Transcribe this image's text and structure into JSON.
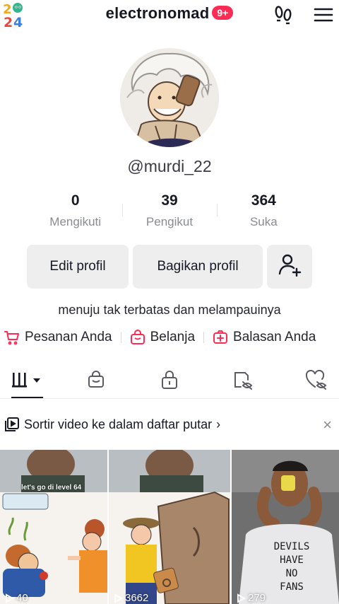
{
  "header": {
    "logo_text": "2024",
    "username": "electronomad",
    "notification_badge": "9+"
  },
  "profile": {
    "handle": "@murdi_22",
    "stats": [
      {
        "value": "0",
        "label": "Mengikuti"
      },
      {
        "value": "39",
        "label": "Pengikut"
      },
      {
        "value": "364",
        "label": "Suka"
      }
    ],
    "edit_button": "Edit profil",
    "share_button": "Bagikan profil",
    "bio": "menuju tak terbatas dan melampauinya"
  },
  "shortcuts": [
    {
      "label": "Pesanan Anda",
      "icon": "cart-icon"
    },
    {
      "label": "Belanja",
      "icon": "shopping-bag-icon"
    },
    {
      "label": "Balasan Anda",
      "icon": "reply-box-icon"
    }
  ],
  "tabs": [
    {
      "name": "videos-grid",
      "icon": "grid-icon",
      "active": true
    },
    {
      "name": "shop",
      "icon": "bag-icon"
    },
    {
      "name": "private",
      "icon": "lock-icon"
    },
    {
      "name": "reposts",
      "icon": "repost-hidden-icon"
    },
    {
      "name": "liked",
      "icon": "heart-hidden-icon"
    }
  ],
  "playlist_banner": {
    "text": "Sortir video ke dalam daftar putar",
    "chevron": "›",
    "close": "×"
  },
  "videos": [
    {
      "views": "40",
      "caption": "let's go di level 64"
    },
    {
      "views": "3662"
    },
    {
      "views": "279",
      "shirt_text": "DEVILS HAVE NO FANS"
    }
  ],
  "colors": {
    "accent": "#fe2c55",
    "text": "#161823",
    "muted": "#8a8b91",
    "button_bg": "#eeeeef"
  }
}
